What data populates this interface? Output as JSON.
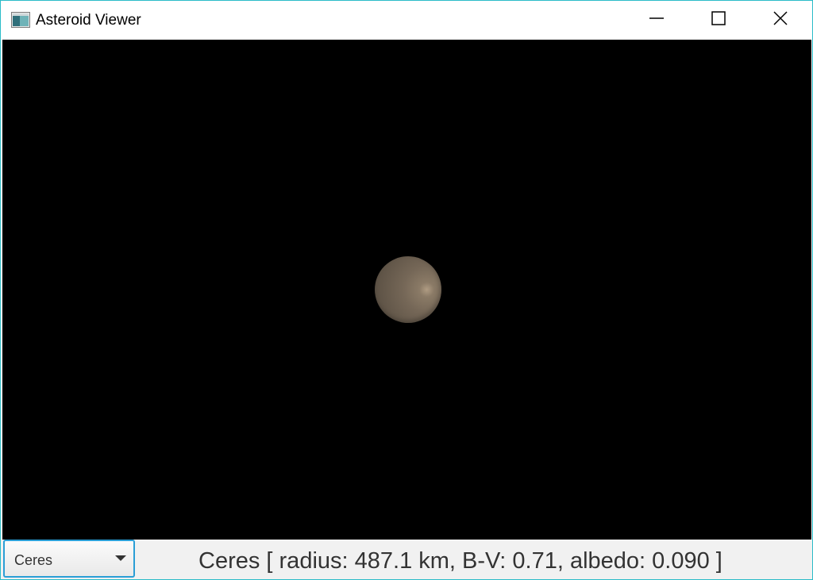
{
  "window": {
    "title": "Asteroid Viewer",
    "icon": "app-window-icon",
    "accent_color": "#2bbcc8",
    "controls": [
      "minimize-icon",
      "maximize-icon",
      "close-icon"
    ]
  },
  "viewport": {
    "background": "#000000",
    "object": {
      "name": "Ceres",
      "shape": "sphere",
      "color": "#756757"
    }
  },
  "bottom_bar": {
    "selector": {
      "selected": "Ceres",
      "icon": "chevron-down-icon",
      "focus_color": "#2a9ed6"
    },
    "info_text": "Ceres [ radius: 487.1 km, B-V: 0.71, albedo: 0.090 ]"
  }
}
